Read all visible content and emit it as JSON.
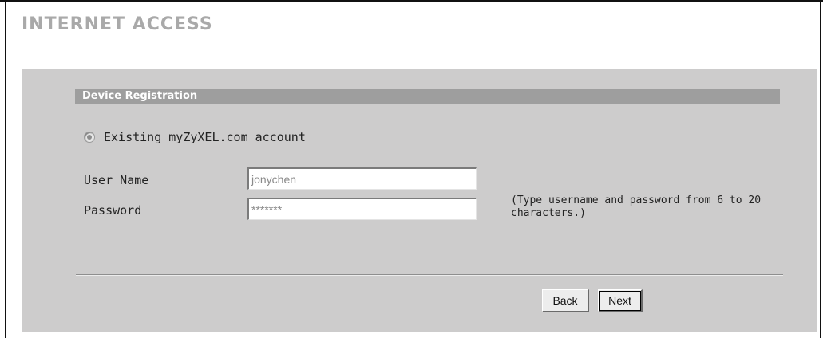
{
  "page": {
    "title": "INTERNET ACCESS"
  },
  "registration": {
    "section_title": "Device Registration",
    "account_option_label": "Existing myZyXEL.com account",
    "account_option_selected": true,
    "username_label": "User Name",
    "username_value": "jonychen",
    "password_label": "Password",
    "password_value": "*******",
    "hint": "(Type username and password from 6 to 20 characters.)"
  },
  "buttons": {
    "back_label": "Back",
    "next_label": "Next"
  }
}
